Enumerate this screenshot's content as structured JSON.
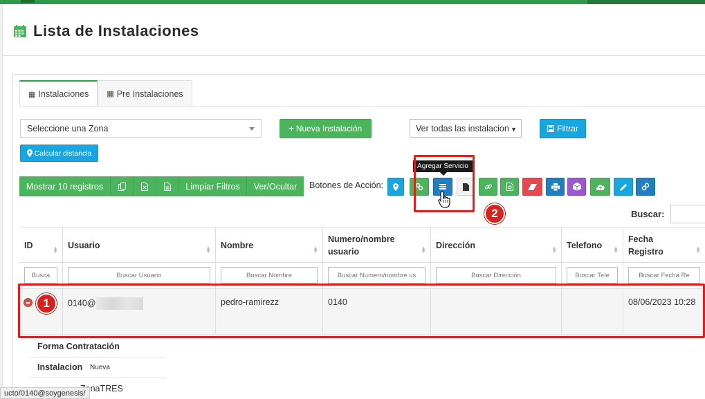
{
  "page": {
    "title": "Lista de Instalaciones"
  },
  "tabs": [
    {
      "label": "Instalaciones",
      "icon": "table-icon",
      "active": true
    },
    {
      "label": "Pre Instalaciones",
      "icon": "table-icon",
      "active": false
    }
  ],
  "filters": {
    "zona_value": "Seleccione una Zona",
    "nueva_label": "Nueva Instalación",
    "ver_value": "Ver todas las instalacion",
    "filtrar_label": "Filtrar",
    "calcular_label": "Calcular distancia"
  },
  "toolbar": {
    "buttons": [
      {
        "label": "Mostrar 10 registros"
      },
      {
        "label": "",
        "icon": "copy-icon"
      },
      {
        "label": "",
        "icon": "excel-icon"
      },
      {
        "label": "",
        "icon": "csv-icon"
      },
      {
        "label": "Limpiar Filtros"
      },
      {
        "label": "Ver/Ocultar"
      }
    ],
    "acciones_label": "Botones de Acción:",
    "action_icons": [
      "map-marker-icon",
      "cogs-icon",
      "add-service-icon",
      "file-icon",
      "link-icon",
      "pdf-icon",
      "eraser-icon",
      "print-icon",
      "cube-icon",
      "cloud-upload-icon",
      "pencil-icon",
      "chain-icon"
    ],
    "tooltip": "Agregar Servicio"
  },
  "search": {
    "label": "Buscar:",
    "value": ""
  },
  "table": {
    "columns": [
      {
        "label": "ID",
        "placeholder": "Busca"
      },
      {
        "label": "Usuario",
        "placeholder": "Buscar Usuario"
      },
      {
        "label": "Nombre",
        "placeholder": "Buscar Nombre"
      },
      {
        "label": "Numero/nombre usuario",
        "placeholder": "Buscar Numero/nombre us"
      },
      {
        "label": "Dirección",
        "placeholder": "Buscar Dirección"
      },
      {
        "label": "Telefono",
        "placeholder": "Buscar Tele"
      },
      {
        "label": "Fecha Registro",
        "placeholder": "Buscar Fecha Re"
      }
    ],
    "rows": [
      {
        "id": "",
        "usuario": "0140@",
        "nombre": "pedro-ramirezz",
        "numero": "0140",
        "direccion": "",
        "telefono": "",
        "fecha": "08/06/2023 10:28"
      }
    ]
  },
  "row_details": [
    {
      "key": "Forma Contratación",
      "value": ""
    },
    {
      "key": "Instalacion",
      "value": "Nueva"
    },
    {
      "key": "",
      "value": "ZonaTRES"
    }
  ],
  "annotations": {
    "badge1": "1",
    "badge2": "2"
  },
  "statusbar": {
    "url": "ucto/0140@soygenesis/"
  },
  "colors": {
    "green": "#4cb45c",
    "cyan": "#17a6e0",
    "blue": "#1f7fc2",
    "red": "#e8484c",
    "purple": "#9b59d0",
    "highlight": "#e01e1e"
  }
}
